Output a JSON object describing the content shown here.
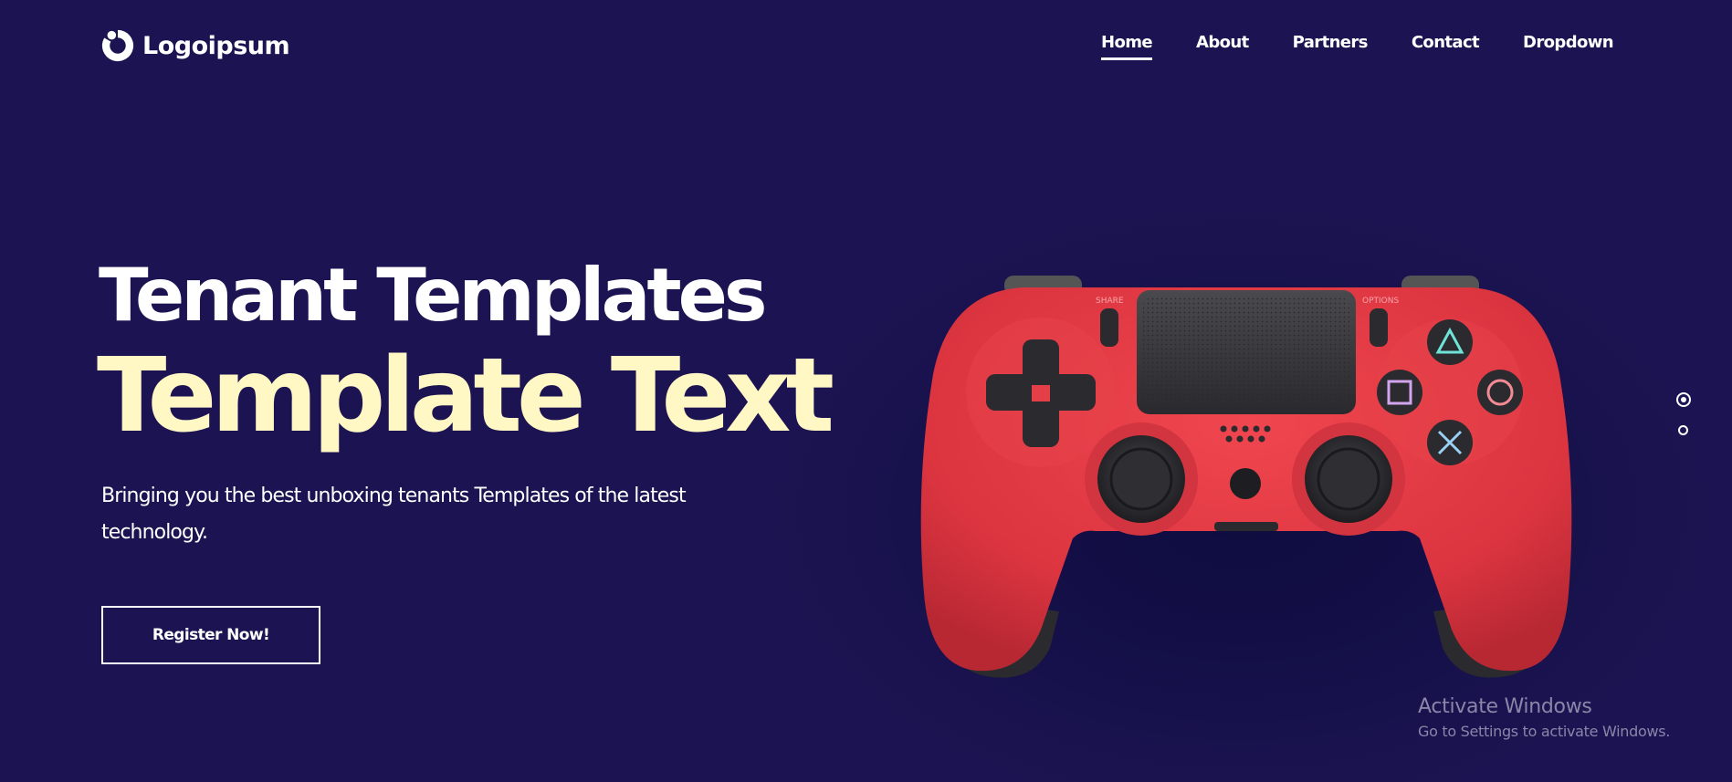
{
  "header": {
    "logo": {
      "icon": "logo-mark-icon",
      "text": "Logoipsum"
    },
    "nav": [
      {
        "label": "Home",
        "active": true
      },
      {
        "label": "About",
        "active": false
      },
      {
        "label": "Partners",
        "active": false
      },
      {
        "label": "Contact",
        "active": false
      },
      {
        "label": "Dropdown",
        "active": false
      }
    ]
  },
  "hero": {
    "title_line1": "Tenant Templates",
    "title_line2": "Template Text",
    "description": "Bringing you the best unboxing tenants Templates of the latest technology.",
    "cta_label": "Register Now!",
    "image": {
      "icon": "game-controller-image",
      "share_label": "SHARE",
      "options_label": "OPTIONS"
    }
  },
  "slider": {
    "dots": 2,
    "active_index": 0
  },
  "watermark": {
    "title": "Activate Windows",
    "subtitle": "Go to Settings to activate Windows."
  },
  "colors": {
    "background": "#1c1452",
    "title_accent": "#fff7c4",
    "text": "#ffffff",
    "controller": "#e33a45"
  }
}
